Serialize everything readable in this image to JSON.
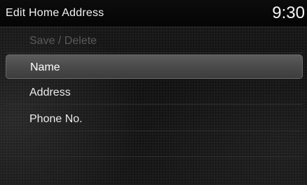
{
  "header": {
    "title": "Edit Home Address",
    "clock": "9:30"
  },
  "menu": {
    "items": [
      {
        "label": "Save / Delete",
        "state": "disabled"
      },
      {
        "label": "Name",
        "state": "selected"
      },
      {
        "label": "Address",
        "state": "normal"
      },
      {
        "label": "Phone No.",
        "state": "normal"
      }
    ]
  },
  "colors": {
    "background": "#141414",
    "header": "#080808",
    "highlight": "#4f4f4f",
    "text": "#ececec",
    "disabled_text": "#5a5a5a"
  }
}
